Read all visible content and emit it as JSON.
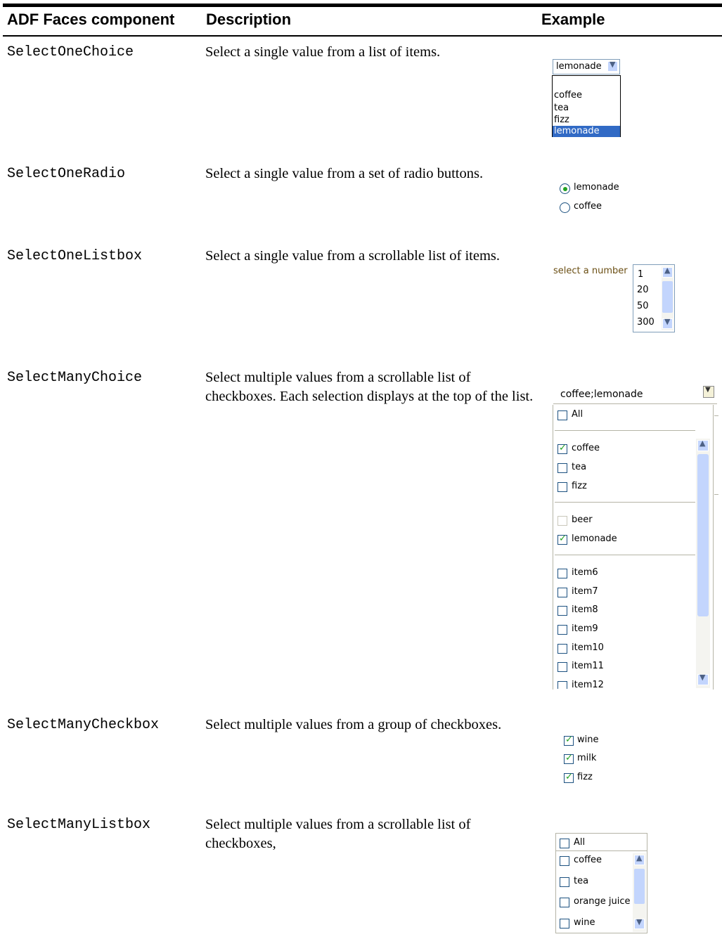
{
  "headers": {
    "component": "ADF Faces component",
    "description": "Description",
    "example": "Example"
  },
  "rows": [
    {
      "component": "SelectOneChoice",
      "description": "Select a single value from a list of items."
    },
    {
      "component": "SelectOneRadio",
      "description": "Select a single value from a set of radio buttons."
    },
    {
      "component": "SelectOneListbox",
      "description": "Select a single value from a scrollable list of items."
    },
    {
      "component": "SelectManyChoice",
      "description": "Select multiple values from a scrollable list of checkboxes. Each selection displays at the top of the list."
    },
    {
      "component": "SelectManyCheckbox",
      "description": "Select multiple values from a group of checkboxes."
    },
    {
      "component": "SelectManyListbox",
      "description": "Select multiple values from a scrollable list of checkboxes,"
    }
  ],
  "select_one_choice": {
    "selected": "lemonade",
    "options": [
      "coffee",
      "tea",
      "fizz",
      "lemonade"
    ]
  },
  "select_one_radio": {
    "options": [
      "lemonade",
      "coffee"
    ],
    "selected": "lemonade"
  },
  "select_one_listbox": {
    "label": "select a number",
    "options": [
      "1",
      "20",
      "50",
      "300"
    ]
  },
  "select_many_choice": {
    "value": "coffee;lemonade",
    "all_label": "All",
    "groups": [
      [
        {
          "label": "coffee",
          "checked": true
        },
        {
          "label": "tea",
          "checked": false
        },
        {
          "label": "fizz",
          "checked": false
        }
      ],
      [
        {
          "label": "beer",
          "checked": false,
          "disabled": true
        },
        {
          "label": "lemonade",
          "checked": true
        }
      ],
      [
        {
          "label": "item6",
          "checked": false
        },
        {
          "label": "item7",
          "checked": false
        },
        {
          "label": "item8",
          "checked": false
        },
        {
          "label": "item9",
          "checked": false
        },
        {
          "label": "item10",
          "checked": false
        },
        {
          "label": "item11",
          "checked": false
        },
        {
          "label": "item12",
          "checked": false
        }
      ]
    ]
  },
  "select_many_checkbox": {
    "options": [
      {
        "label": "wine",
        "checked": true
      },
      {
        "label": "milk",
        "checked": true
      },
      {
        "label": "fizz",
        "checked": true
      }
    ]
  },
  "select_many_listbox": {
    "all_label": "All",
    "options": [
      {
        "label": "coffee",
        "checked": false
      },
      {
        "label": "tea",
        "checked": false
      },
      {
        "label": "orange juice",
        "checked": false
      },
      {
        "label": "wine",
        "checked": false
      }
    ]
  }
}
